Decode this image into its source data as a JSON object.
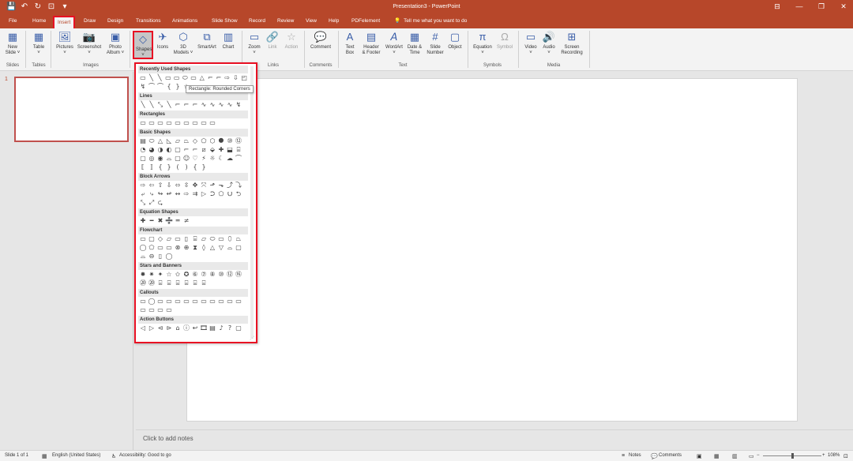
{
  "window": {
    "title": "Presentation3 - PowerPoint",
    "qat": [
      "save-icon",
      "undo-icon",
      "redo-icon",
      "start-from-beginning-icon",
      "customize-qat-icon"
    ],
    "controls": [
      "ribbon-display-icon",
      "minimize-icon",
      "maximize-icon",
      "close-icon"
    ]
  },
  "tabs": [
    {
      "label": "File"
    },
    {
      "label": "Home"
    },
    {
      "label": "Insert",
      "active": true
    },
    {
      "label": "Draw"
    },
    {
      "label": "Design"
    },
    {
      "label": "Transitions"
    },
    {
      "label": "Animations"
    },
    {
      "label": "Slide Show"
    },
    {
      "label": "Record"
    },
    {
      "label": "Review"
    },
    {
      "label": "View"
    },
    {
      "label": "Help"
    },
    {
      "label": "PDFelement"
    }
  ],
  "tell_me": "Tell me what you want to do",
  "ribbon": {
    "new_slide": [
      "New",
      "Slide ˅"
    ],
    "table": [
      "Table",
      "˅"
    ],
    "pictures": [
      "Pictures",
      "˅"
    ],
    "screenshot": [
      "Screenshot",
      "˅"
    ],
    "photo_album": [
      "Photo",
      "Album ˅"
    ],
    "shapes": [
      "Shapes",
      "˅"
    ],
    "icons": [
      "Icons"
    ],
    "models_3d": [
      "3D",
      "Models ˅"
    ],
    "smartart": [
      "SmartArt"
    ],
    "chart": [
      "Chart"
    ],
    "zoom": [
      "Zoom",
      "˅"
    ],
    "link": [
      "Link"
    ],
    "action": [
      "Action"
    ],
    "comment": [
      "Comment"
    ],
    "text_box": [
      "Text",
      "Box"
    ],
    "header_footer": [
      "Header",
      "& Footer"
    ],
    "wordart": [
      "WordArt",
      "˅"
    ],
    "date_time": [
      "Date &",
      "Time"
    ],
    "slide_number": [
      "Slide",
      "Number"
    ],
    "object": [
      "Object"
    ],
    "equation": [
      "Equation",
      "˅"
    ],
    "symbol": [
      "Symbol"
    ],
    "video": [
      "Video",
      "˅"
    ],
    "audio": [
      "Audio",
      "˅"
    ],
    "screen_recording": [
      "Screen",
      "Recording"
    ],
    "groups": {
      "slides": "Slides",
      "tables": "Tables",
      "images": "Images",
      "links": "Links",
      "comments": "Comments",
      "text": "Text",
      "symbols": "Symbols",
      "media": "Media"
    }
  },
  "shapes_menu": {
    "sections": [
      {
        "label": "Recently Used Shapes",
        "rows": [
          [
            "▭",
            "╲",
            "╲",
            "▭",
            "▭",
            "⬭",
            "▭",
            "△",
            "⌐",
            "⌐",
            "⇨",
            "⇩",
            "◰"
          ],
          [
            "↯",
            "⌒",
            "⌒",
            "{",
            "}",
            "☆"
          ]
        ]
      },
      {
        "label": "Lines",
        "rows": [
          [
            "╲",
            "╲",
            "⤡",
            "╲",
            "⌐",
            "⌐",
            "⌐",
            "∿",
            "∿",
            "∿",
            "∿",
            "↯"
          ]
        ]
      },
      {
        "label": "Rectangles",
        "rows": [
          [
            "▭",
            "▭",
            "▭",
            "▭",
            "▭",
            "▭",
            "▭",
            "▭",
            "▭"
          ]
        ]
      },
      {
        "label": "Basic Shapes",
        "rows": [
          [
            "▤",
            "⬭",
            "△",
            "◺",
            "▱",
            "⏢",
            "◇",
            "⬠",
            "⬡",
            "⯃",
            "⑩",
            "⑫"
          ],
          [
            "◔",
            "◕",
            "◑",
            "◐",
            "▢",
            "⌐",
            "⌐",
            "⧄",
            "⬙",
            "✚",
            "⬓",
            "⌸"
          ],
          [
            "▢",
            "◎",
            "◉",
            "⌓",
            "▢",
            "☺",
            "♡",
            "⚡",
            "☼",
            "☾",
            "☁",
            "⌒"
          ],
          [
            "⟦",
            "⟧",
            "{",
            "}",
            "(",
            ")",
            "{",
            "}"
          ]
        ]
      },
      {
        "label": "Block Arrows",
        "rows": [
          [
            "⇨",
            "⇦",
            "⇧",
            "⇩",
            "⬄",
            "⇳",
            "✥",
            "⤧",
            "⬏",
            "⬎",
            "⤴",
            "⤵"
          ],
          [
            "⤶",
            "⤷",
            "↬",
            "↫",
            "↭",
            "⇨",
            "⇉",
            "▷",
            "⮊",
            "⬠",
            "⮋",
            "⮌"
          ],
          [
            "⤡",
            "⤢",
            "⮎"
          ]
        ]
      },
      {
        "label": "Equation Shapes",
        "rows": [
          [
            "✚",
            "━",
            "✖",
            "➗",
            "═",
            "≠"
          ]
        ]
      },
      {
        "label": "Flowchart",
        "rows": [
          [
            "▭",
            "▢",
            "◇",
            "▱",
            "▭",
            "▯",
            "⌸",
            "▱",
            "⬭",
            "▭",
            "⬯",
            "⏢"
          ],
          [
            "◯",
            "⬠",
            "▭",
            "▭",
            "⊗",
            "⊕",
            "⧗",
            "◊",
            "△",
            "▽",
            "⌓",
            "▢"
          ],
          [
            "⌓",
            "⊖",
            "▯",
            "◯"
          ]
        ]
      },
      {
        "label": "Stars and Banners",
        "rows": [
          [
            "✸",
            "✷",
            "✦",
            "☆",
            "✩",
            "✪",
            "⑥",
            "⑦",
            "⑧",
            "⑩",
            "⑫",
            "⑯"
          ],
          [
            "⑳",
            "⑳",
            "⌸",
            "⌸",
            "⌸",
            "⌸",
            "⌸",
            "⌸"
          ]
        ]
      },
      {
        "label": "Callouts",
        "rows": [
          [
            "▭",
            "◯",
            "▭",
            "▭",
            "▭",
            "▭",
            "▭",
            "▭",
            "▭",
            "▭",
            "▭",
            "▭"
          ],
          [
            "▭",
            "▭",
            "▭",
            "▭"
          ]
        ]
      },
      {
        "label": "Action Buttons",
        "rows": [
          [
            "◁",
            "▷",
            "⊲",
            "⊳",
            "⌂",
            "ⓘ",
            "↩",
            "🎞",
            "▤",
            "♪",
            "?",
            "▢"
          ]
        ]
      }
    ]
  },
  "tooltip": "Rectangle: Rounded Corners",
  "slide_panel": {
    "number": "1"
  },
  "notes_placeholder": "Click to add notes",
  "status": {
    "slide_of": "Slide 1 of 1",
    "language": "English (United States)",
    "accessibility": "Accessibility: Good to go",
    "notes": "Notes",
    "comments": "Comments",
    "zoom": "108%",
    "zoom_position": 0.5
  }
}
